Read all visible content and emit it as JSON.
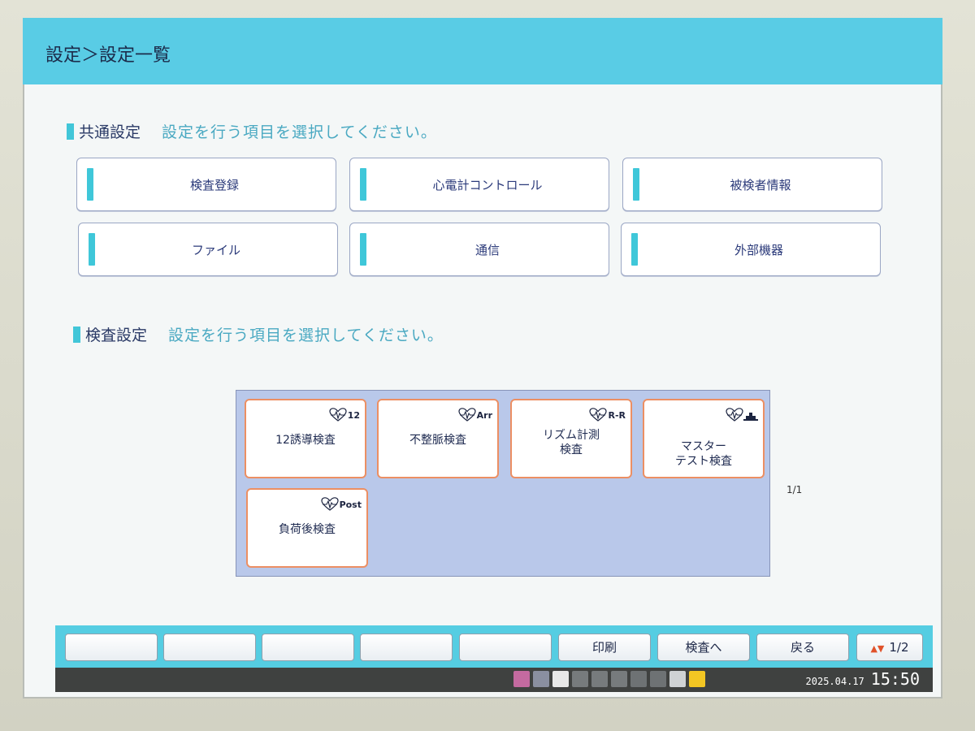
{
  "header": {
    "title": "設定＞設定一覧"
  },
  "common": {
    "heading": "共通設定",
    "hint": "設定を行う項目を選択してください。",
    "buttons": [
      {
        "label": "検査登録"
      },
      {
        "label": "心電計コントロール"
      },
      {
        "label": "被検者情報"
      },
      {
        "label": "ファイル"
      },
      {
        "label": "通信"
      },
      {
        "label": "外部機器"
      }
    ]
  },
  "exam": {
    "heading": "検査設定",
    "hint": "設定を行う項目を選択してください。",
    "items": [
      {
        "label": "12誘導検査",
        "badge": "12",
        "icon": "heart-ecg-icon"
      },
      {
        "label": "不整脈検査",
        "badge": "Arr",
        "icon": "heart-ecg-icon"
      },
      {
        "label": "リズム計測\n検査",
        "badge": "R-R",
        "icon": "heart-ecg-icon"
      },
      {
        "label": "マスター\nテスト検査",
        "badge": "",
        "icon": "heart-steps-icon"
      },
      {
        "label": "負荷後検査",
        "badge": "Post",
        "icon": "heart-ecg-icon"
      }
    ],
    "pager": "1/1"
  },
  "footer": {
    "buttons": [
      {
        "label": ""
      },
      {
        "label": ""
      },
      {
        "label": ""
      },
      {
        "label": ""
      },
      {
        "label": ""
      },
      {
        "label": "印刷"
      },
      {
        "label": "検査へ"
      },
      {
        "label": "戻る"
      },
      {
        "label": "1/2"
      }
    ]
  },
  "status": {
    "date": "2025.04.17",
    "time": "15:50",
    "icons": [
      "signal-icon",
      "download-icon",
      "user-icon",
      "lock-icon",
      "lock-icon",
      "lock-icon",
      "sd-card-icon",
      "cf-card-icon",
      "power-plug-icon",
      "warning-icon"
    ],
    "colors": {
      "accent": "#59cce5",
      "exam_border": "#ec8f63",
      "warning": "#f3c623"
    }
  }
}
